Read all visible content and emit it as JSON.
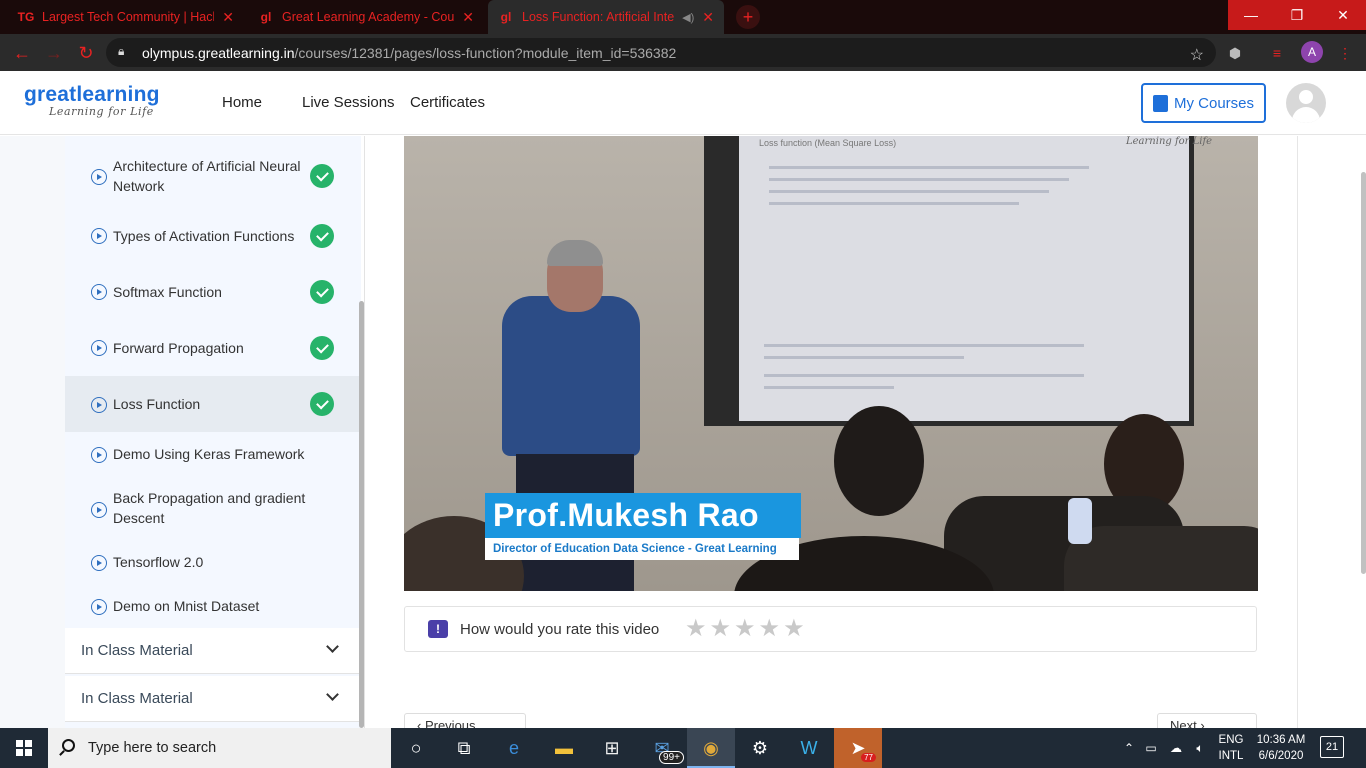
{
  "browser": {
    "tabs": [
      {
        "icon": "TG",
        "title": "Largest Tech Community | Hackat",
        "active": false
      },
      {
        "icon": "gl",
        "title": "Great Learning Academy - Course",
        "active": false
      },
      {
        "icon": "gl",
        "title": "Loss Function: Artificial Intelli",
        "active": true
      }
    ],
    "url_domain": "olympus.greatlearning.in",
    "url_path": "/courses/12381/pages/loss-function?module_item_id=536382",
    "profile_initial": "A"
  },
  "header": {
    "logo_main": "greatlearning",
    "logo_tagline": "Learning for Life",
    "nav": [
      "Home",
      "Live Sessions",
      "Certificates"
    ],
    "my_courses": "My Courses"
  },
  "sidebar": {
    "items": [
      {
        "label": "Architecture of Artificial Neural Network",
        "done": true
      },
      {
        "label": "Types of Activation Functions",
        "done": true
      },
      {
        "label": "Softmax Function",
        "done": true
      },
      {
        "label": "Forward Propagation",
        "done": true
      },
      {
        "label": "Loss Function",
        "done": true,
        "active": true
      },
      {
        "label": "Demo Using Keras Framework",
        "done": false
      },
      {
        "label": "Back Propagation and gradient Descent",
        "done": false
      },
      {
        "label": "Tensorflow 2.0",
        "done": false
      },
      {
        "label": "Demo on Mnist Dataset",
        "done": false
      }
    ],
    "sections": [
      "In Class Material",
      "In Class Material"
    ]
  },
  "video": {
    "slide_title": "Loss function (Mean Square Loss)",
    "watermark": "Learning for Life",
    "speaker_name": "Prof.Mukesh Rao",
    "speaker_title": "Director of Education Data Science - Great Learning"
  },
  "rating": {
    "prompt": "How would you rate this video",
    "stars": 5,
    "value": 0
  },
  "pager": {
    "prev": "Previous",
    "next": "Next"
  },
  "taskbar": {
    "search_placeholder": "Type here to search",
    "store_badge": "99+",
    "telegram_badge": "77",
    "lang_top": "ENG",
    "lang_bottom": "INTL",
    "time": "10:36 AM",
    "date": "6/6/2020",
    "notifications": "21"
  },
  "colors": {
    "brand": "#1e6fd9",
    "check": "#27b36a",
    "browser_accent": "#e82222",
    "caption_blue": "#1a96df"
  }
}
